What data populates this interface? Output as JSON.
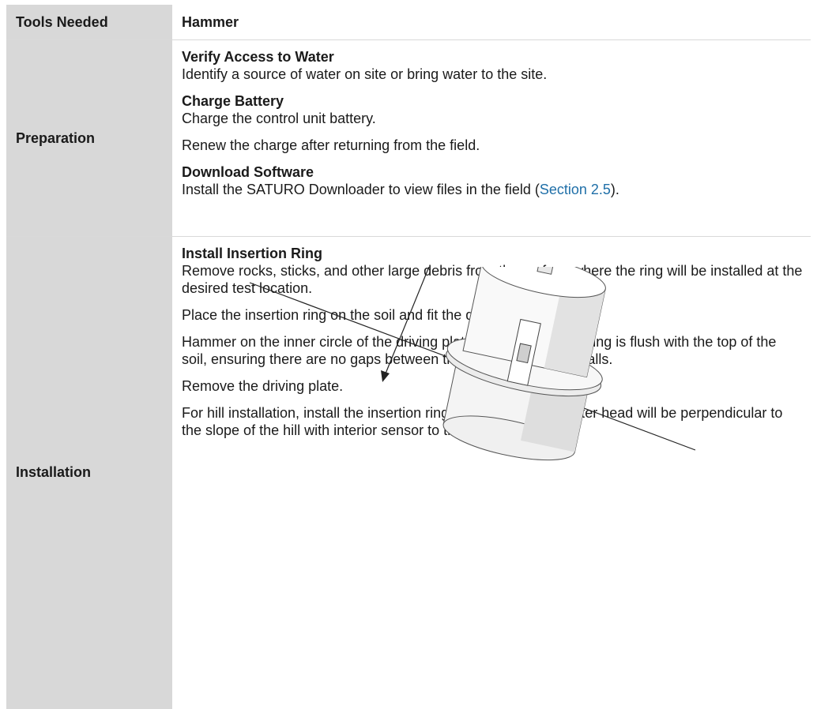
{
  "tools_row": {
    "label": "Tools Needed",
    "value": "Hammer"
  },
  "preparation": {
    "label": "Preparation",
    "steps": [
      {
        "title": "Verify Access to Water",
        "text": "Identify a source of water on site or bring water to the site."
      },
      {
        "title": "Charge Battery",
        "text": "Charge the control unit battery.",
        "extra": "Renew the charge after returning from the field."
      },
      {
        "title": "Download Software",
        "text_before": "Install the SATURO Downloader to view files in the field (",
        "link": "Section 2.5",
        "text_after": ")."
      }
    ]
  },
  "installation": {
    "label": "Installation",
    "title": "Install Insertion Ring",
    "paragraphs": [
      "Remove rocks, sticks, and other large debris from the surface where the ring will be installed at the desired test location.",
      "Place the insertion ring on the soil and fit the driving plate on top.",
      "Hammer on the inner circle of the driving plate until the insertion ring is flush with the top of the soil, ensuring there are no gaps between the soil and ring side walls.",
      "Remove the driving plate.",
      "For hill installation, install the insertion ring so that the infiltrometer head will be perpendicular to the slope of the hill with interior sensor to the left or right."
    ]
  },
  "colors": {
    "label_bg": "#d8d8d8",
    "link": "#1f6fa8",
    "divider": "#d9d9d9"
  }
}
